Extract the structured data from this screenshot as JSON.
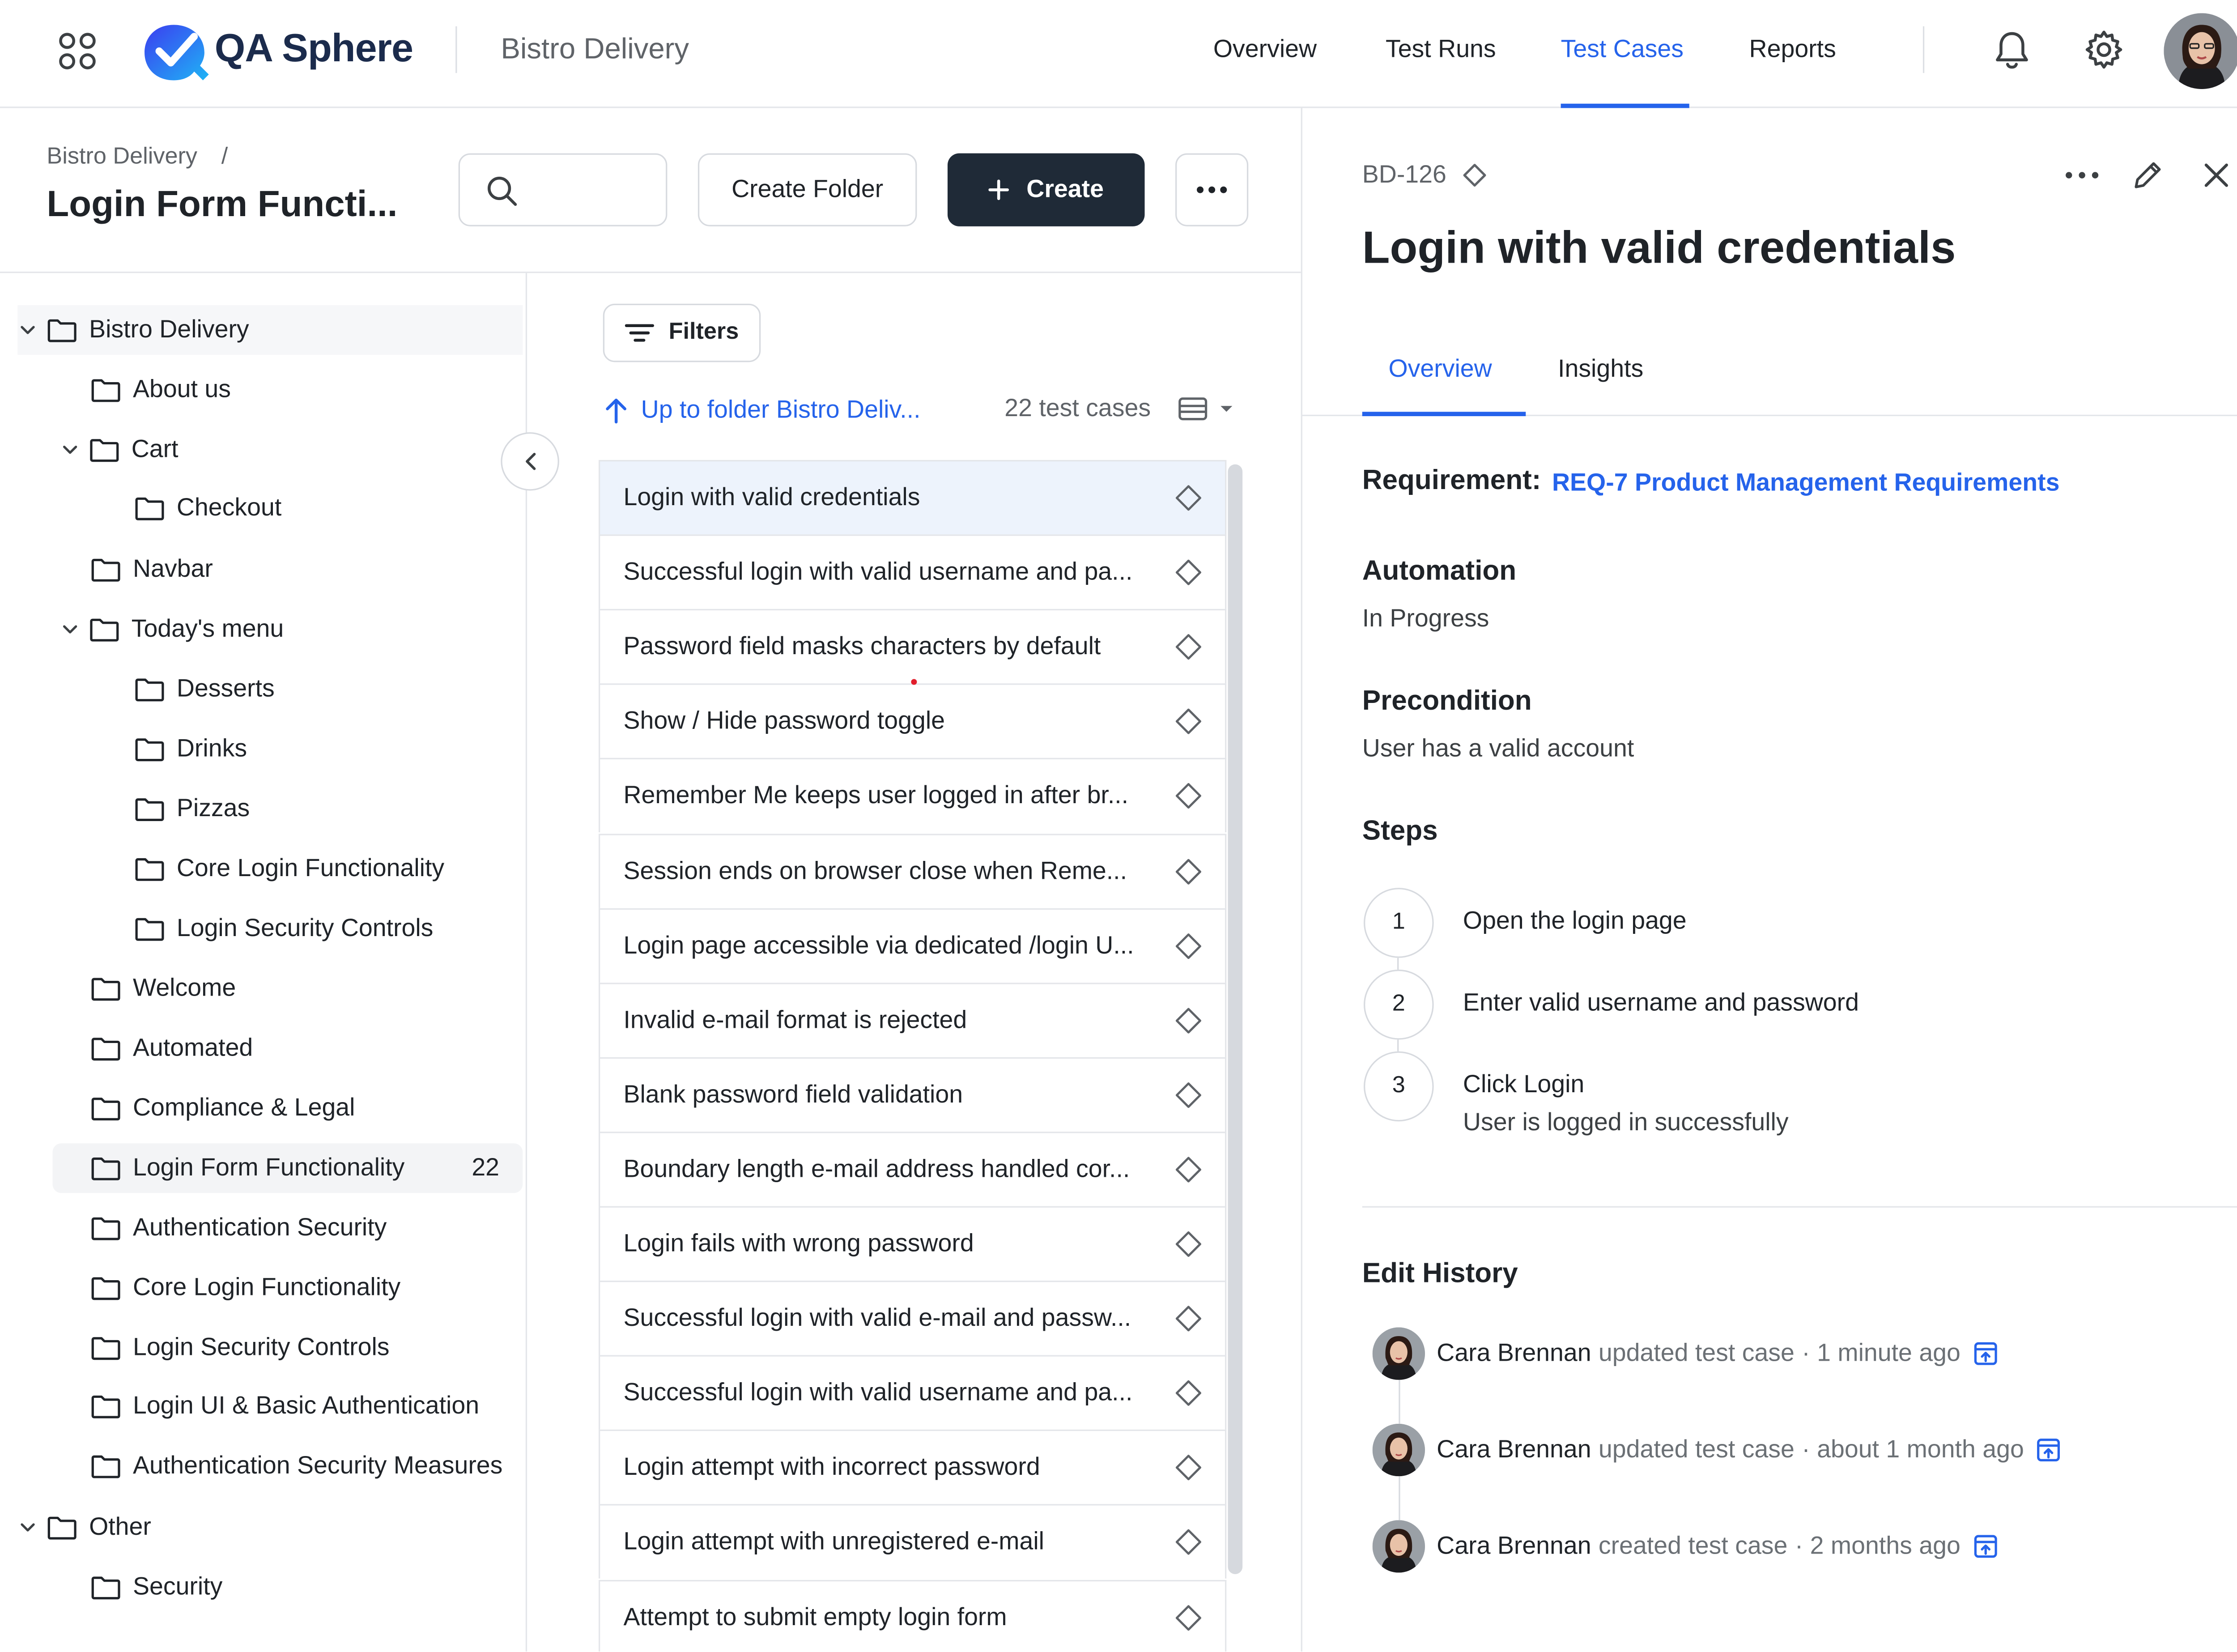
{
  "app": {
    "brand": "QA Sphere",
    "project": "Bistro Delivery",
    "accent_color": "#2563eb",
    "dark_button_color": "#1f2a37"
  },
  "nav": {
    "items": [
      {
        "label": "Overview",
        "active": false
      },
      {
        "label": "Test Runs",
        "active": false
      },
      {
        "label": "Test Cases",
        "active": true
      },
      {
        "label": "Reports",
        "active": false
      }
    ],
    "icons": [
      "apps-grid-icon",
      "bell-icon",
      "gear-icon"
    ]
  },
  "header": {
    "breadcrumb_root": "Bistro Delivery",
    "breadcrumb_sep": "/",
    "title": "Login Form Functi...",
    "create_folder_label": "Create Folder",
    "create_label": "Create"
  },
  "tree": [
    {
      "label": "Bistro Delivery",
      "expanded": true
    },
    {
      "label": "About us"
    },
    {
      "label": "Cart",
      "expanded": true
    },
    {
      "label": "Checkout"
    },
    {
      "label": "Navbar"
    },
    {
      "label": "Today's menu",
      "expanded": true
    },
    {
      "label": "Desserts"
    },
    {
      "label": "Drinks"
    },
    {
      "label": "Pizzas"
    },
    {
      "label": "Core Login Functionality"
    },
    {
      "label": "Login Security Controls"
    },
    {
      "label": "Welcome"
    },
    {
      "label": "Automated"
    },
    {
      "label": "Compliance & Legal"
    },
    {
      "label": "Login Form Functionality",
      "count": "22",
      "selected": true
    },
    {
      "label": "Authentication Security"
    },
    {
      "label": "Core Login Functionality"
    },
    {
      "label": "Login Security Controls"
    },
    {
      "label": "Login UI & Basic Authentication"
    },
    {
      "label": "Authentication Security Measures"
    },
    {
      "label": "Other",
      "expanded": true
    },
    {
      "label": "Security"
    }
  ],
  "list": {
    "filters_label": "Filters",
    "up_link": "Up to folder Bistro Deliv...",
    "count_label": "22 test cases",
    "cases": [
      "Login with valid credentials",
      "Successful login with valid username and pa...",
      "Password field masks characters by default",
      "Show / Hide password toggle",
      "Remember Me keeps user logged in after br...",
      "Session ends on browser close when Reme...",
      "Login page accessible via dedicated /login U...",
      "Invalid e-mail format is rejected",
      "Blank password field validation",
      "Boundary length e-mail address handled cor...",
      "Login fails with wrong password",
      "Successful login with valid e-mail and passw...",
      "Successful login with valid username and pa...",
      "Login attempt with incorrect password",
      "Login attempt with unregistered e-mail",
      "Attempt to submit empty login form"
    ]
  },
  "detail": {
    "id": "BD-126",
    "title": "Login with valid credentials",
    "tabs": [
      {
        "label": "Overview",
        "active": true
      },
      {
        "label": "Insights",
        "active": false
      }
    ],
    "requirement_label": "Requirement:",
    "requirement_link": "REQ-7 Product Management Requirements",
    "automation_label": "Automation",
    "automation_value": "In Progress",
    "precondition_label": "Precondition",
    "precondition_value": "User has a valid account",
    "steps_label": "Steps",
    "steps": [
      {
        "num": "1",
        "text": "Open the login page",
        "result": ""
      },
      {
        "num": "2",
        "text": "Enter valid username and password",
        "result": ""
      },
      {
        "num": "3",
        "text": "Click Login",
        "result": "User is logged in successfully"
      }
    ],
    "history_label": "Edit History",
    "history": [
      {
        "user": "Cara Brennan",
        "action": "updated test case",
        "time": "· 1 minute ago"
      },
      {
        "user": "Cara Brennan",
        "action": "updated test case",
        "time": "· about 1 month ago"
      },
      {
        "user": "Cara Brennan",
        "action": "created test case",
        "time": "· 2 months ago"
      }
    ]
  }
}
